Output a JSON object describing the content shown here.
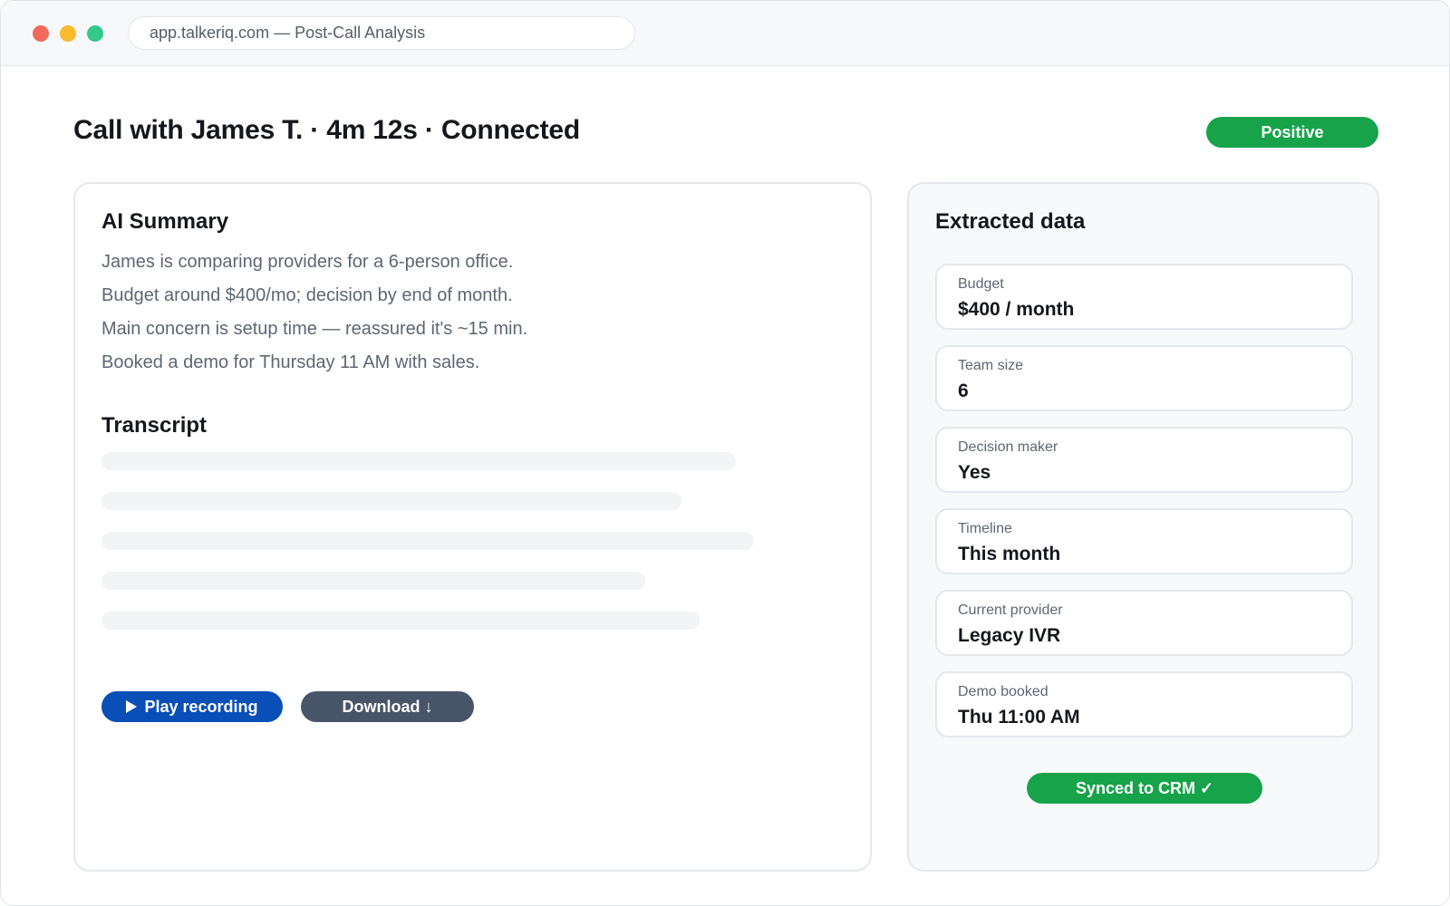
{
  "browser": {
    "url": "app.talkeriq.com — Post-Call Analysis"
  },
  "header": {
    "title": "Call with James T. · 4m 12s · Connected",
    "sentiment": "Positive"
  },
  "summary": {
    "heading": "AI Summary",
    "lines": [
      "James is comparing providers for a 6-person office.",
      "Budget around $400/mo; decision by end of month.",
      "Main concern is setup time — reassured it's ~15 min.",
      "Booked a demo for Thursday 11 AM with sales."
    ]
  },
  "transcript": {
    "heading": "Transcript"
  },
  "actions": {
    "play_label": "Play recording",
    "download_label": "Download ↓"
  },
  "extracted": {
    "heading": "Extracted data",
    "fields": [
      {
        "label": "Budget",
        "value": "$400 / month"
      },
      {
        "label": "Team size",
        "value": "6"
      },
      {
        "label": "Decision maker",
        "value": "Yes"
      },
      {
        "label": "Timeline",
        "value": "This month"
      },
      {
        "label": "Current provider",
        "value": "Legacy IVR"
      },
      {
        "label": "Demo booked",
        "value": "Thu 11:00 AM"
      }
    ],
    "sync_label": "Synced to CRM ✓"
  },
  "colors": {
    "positive": "#17a34a",
    "primary": "#0a4fb8",
    "secondary": "#485569"
  },
  "icons": {
    "play": "play-icon"
  }
}
